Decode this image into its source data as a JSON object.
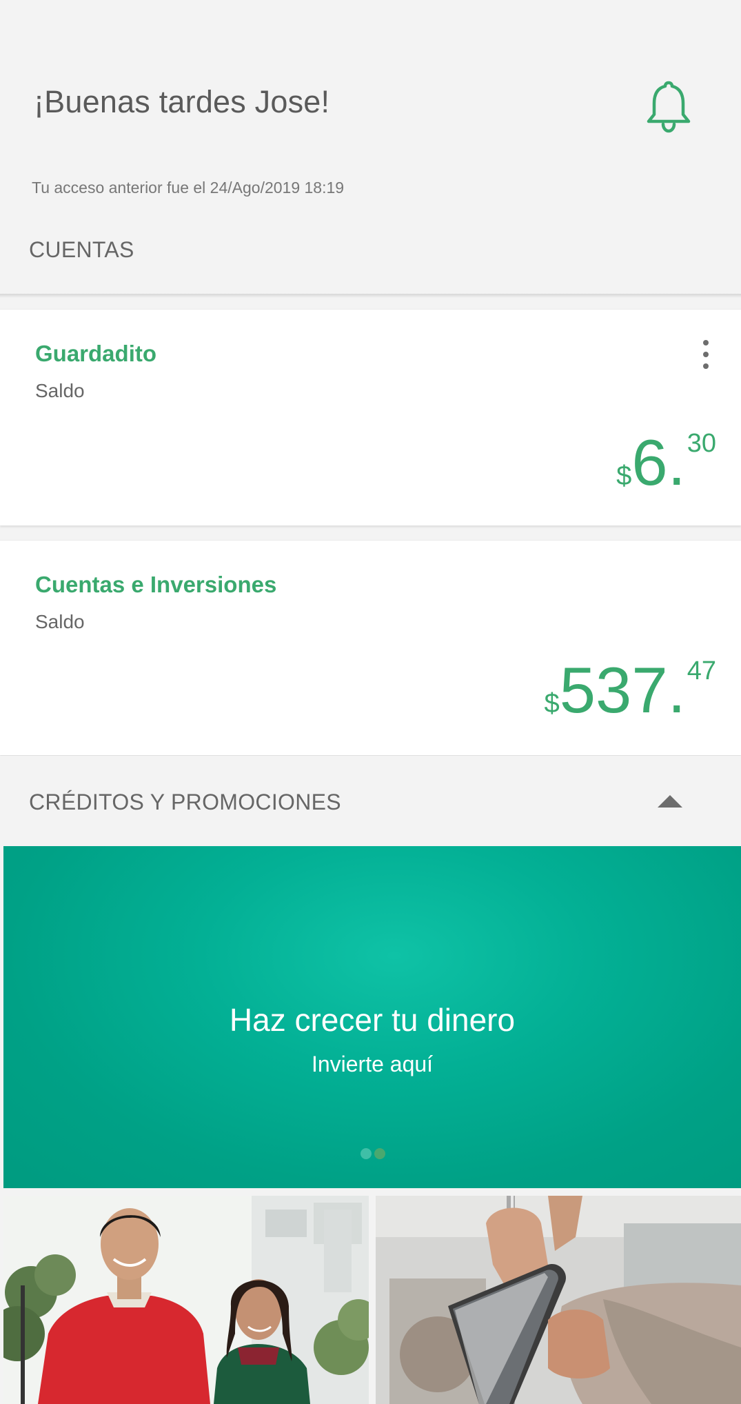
{
  "header": {
    "greeting": "¡Buenas tardes Jose!",
    "last_access": "Tu acceso anterior fue el 24/Ago/2019 18:19",
    "notification_icon": "bell-icon"
  },
  "accounts": {
    "section_title": "CUENTAS",
    "items": [
      {
        "name": "Guardadito",
        "label": "Saldo",
        "currency": "$",
        "amount_int": "6.",
        "amount_cents": "30",
        "menu_icon": "more-vertical-icon"
      },
      {
        "name": "Cuentas e Inversiones",
        "label": "Saldo",
        "currency": "$",
        "amount_int": "537.",
        "amount_cents": "47"
      }
    ]
  },
  "promos": {
    "section_title": "CRÉDITOS Y PROMOCIONES",
    "toggle_icon": "chevron-up-icon",
    "banner": {
      "title": "Haz crecer tu dinero",
      "subtitle": "Invierte aquí",
      "pages": 2,
      "active_page": 2
    },
    "tiles": [
      {
        "icon": "couple-photo"
      },
      {
        "icon": "phone-in-hand-photo"
      }
    ]
  },
  "colors": {
    "accent": "#3aa96e",
    "banner": "#00a88c",
    "background": "#f3f3f3",
    "text": "#5a5a5a"
  }
}
